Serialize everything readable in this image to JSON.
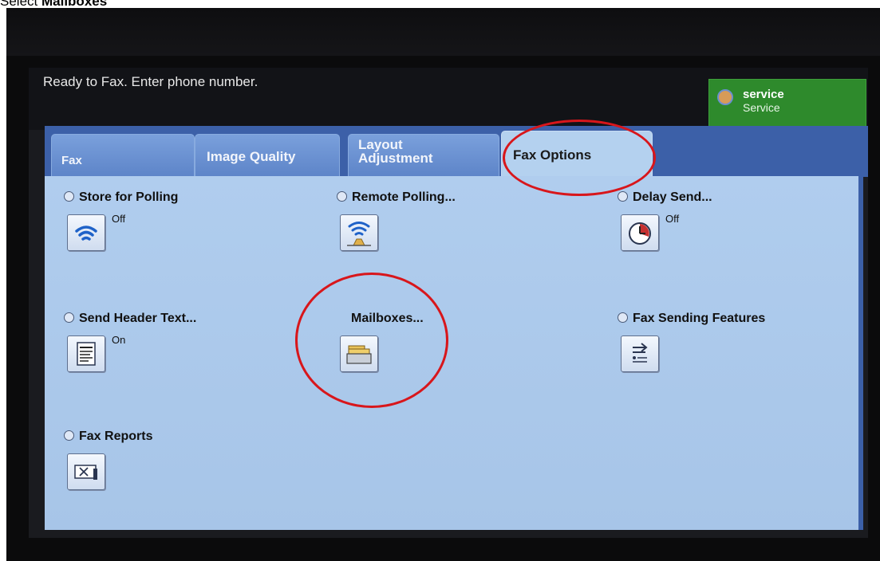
{
  "caption": {
    "prefix": "Select ",
    "emphasis": "Mailboxes"
  },
  "status": {
    "message": "Ready to Fax. Enter phone number."
  },
  "user": {
    "login": "service",
    "name": "Service"
  },
  "tabs": [
    {
      "label": "Fax"
    },
    {
      "label": "Image Quality"
    },
    {
      "label_line1": "Layout",
      "label_line2": "Adjustment"
    },
    {
      "label": "Fax Options"
    }
  ],
  "options": {
    "store_for_polling": {
      "label": "Store for Polling",
      "state": "Off",
      "icon": "wireless-signal-icon"
    },
    "remote_polling": {
      "label": "Remote Polling...",
      "icon": "signal-tower-icon"
    },
    "delay_send": {
      "label": "Delay Send...",
      "state": "Off",
      "icon": "clock-icon"
    },
    "send_header_text": {
      "label": "Send Header Text...",
      "state": "On",
      "icon": "document-lines-icon"
    },
    "mailboxes": {
      "label": "Mailboxes...",
      "icon": "folder-tray-icon"
    },
    "fax_sending_features": {
      "label": "Fax Sending Features",
      "icon": "arrow-list-icon"
    },
    "fax_reports": {
      "label": "Fax Reports",
      "icon": "report-x-icon"
    }
  },
  "colors": {
    "annotation_circle": "#d8161b",
    "tab_bar": "#3c60a8",
    "panel": "#b0cdee",
    "user_badge": "#2e8a2c"
  }
}
